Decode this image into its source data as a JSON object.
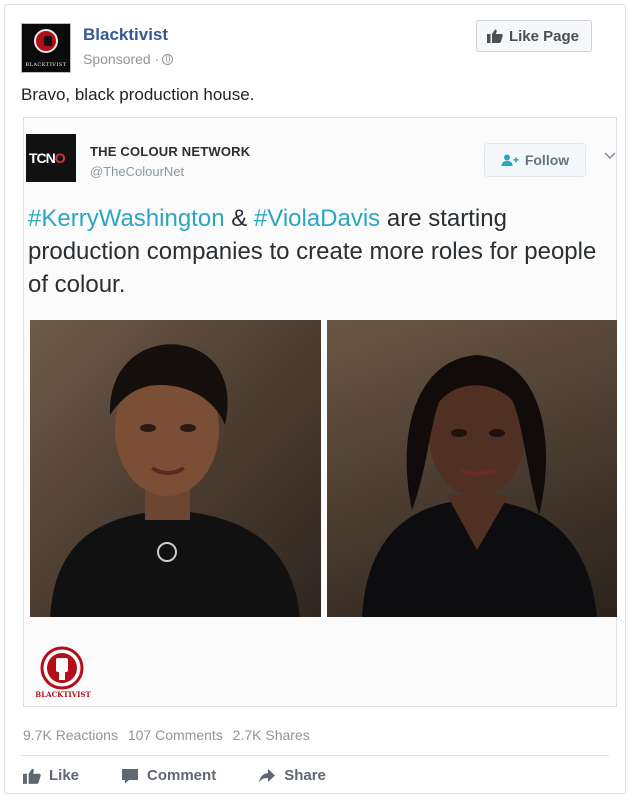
{
  "post": {
    "page_name": "Blacktivist",
    "avatar_wordmark": "BLACKTIVIST",
    "sponsored_label": "Sponsored ·",
    "like_page_label": "Like Page",
    "caption": "Bravo, black production house."
  },
  "shared_tweet": {
    "logo_text_main": "TCN",
    "logo_text_accent": "O",
    "account_name": "THE COLOUR NETWORK",
    "handle": "@TheColourNet",
    "follow_label": "Follow",
    "text_hashtag_1": "#KerryWashington",
    "text_amp": " & ",
    "text_hashtag_2": "#ViolaDavis",
    "text_body": " are starting production companies to create more roles for people of colour.",
    "footer_logo_wordmark": "BLACKTIVIST"
  },
  "stats": {
    "reactions": "9.7K Reactions",
    "comments": "107 Comments",
    "shares": "2.7K Shares"
  },
  "actions": {
    "like": "Like",
    "comment": "Comment",
    "share": "Share"
  },
  "colors": {
    "link_blue": "#365899",
    "hashtag_teal": "#2aa6c2",
    "brand_red": "#b30f19"
  }
}
